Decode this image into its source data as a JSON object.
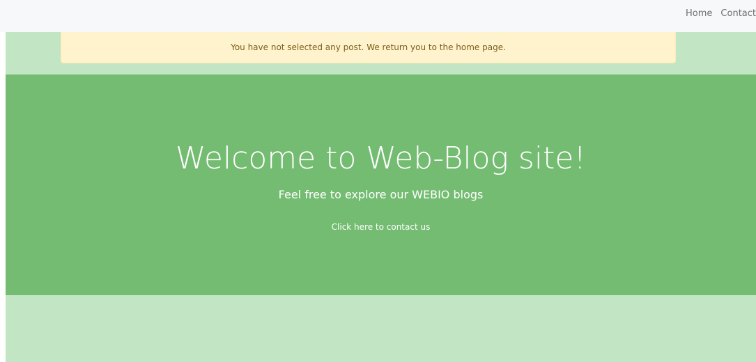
{
  "nav": {
    "home_label": "Home",
    "contact_label": "Contact"
  },
  "alert": {
    "message": "You have not selected any post. We return you to the home page."
  },
  "hero": {
    "title": "Welcome to Web-Blog site!",
    "subtitle": "Feel free to explore our WEBIO blogs",
    "contact_link": "Click here to contact us"
  },
  "colors": {
    "navbar_bg": "#f7f8fa",
    "page_bg": "#c2e5c3",
    "alert_bg": "#fff3cd",
    "hero_bg": "#74bc72"
  }
}
